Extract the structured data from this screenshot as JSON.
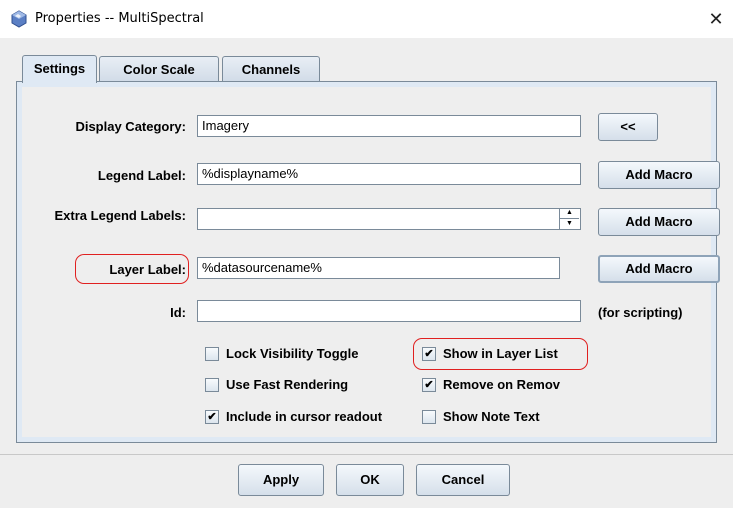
{
  "window": {
    "title": "Properties -- MultiSpectral",
    "close_glyph": "✕",
    "app_icon": "multispectral-icon"
  },
  "tabs": [
    {
      "label": "Settings",
      "active": true
    },
    {
      "label": "Color Scale",
      "active": false
    },
    {
      "label": "Channels",
      "active": false
    }
  ],
  "settings": {
    "display_category": {
      "label": "Display Category:",
      "value": "Imagery",
      "button": "<<"
    },
    "legend_label": {
      "label": "Legend Label:",
      "value": "%displayname%",
      "button": "Add Macro"
    },
    "extra_legend_labels": {
      "label": "Extra Legend Labels:",
      "value": "",
      "button": "Add Macro"
    },
    "layer_label": {
      "label": "Layer Label:",
      "value": "%datasourcename%",
      "button": "Add Macro"
    },
    "id": {
      "label": "Id:",
      "value": "",
      "note": "(for scripting)"
    },
    "checkboxes": [
      {
        "label": "Lock Visibility Toggle",
        "checked": false
      },
      {
        "label": "Show in Layer List",
        "checked": true
      },
      {
        "label": "Use Fast Rendering",
        "checked": false
      },
      {
        "label": "Remove on Remov",
        "checked": true
      },
      {
        "label": "Include in cursor readout",
        "checked": true
      },
      {
        "label": "Show Note Text",
        "checked": false
      }
    ],
    "check_glyph": "✔"
  },
  "footer": {
    "apply": "Apply",
    "ok": "OK",
    "cancel": "Cancel"
  },
  "colors": {
    "highlight_oval": "#e02020",
    "tab_active": "#dfe9f4"
  }
}
